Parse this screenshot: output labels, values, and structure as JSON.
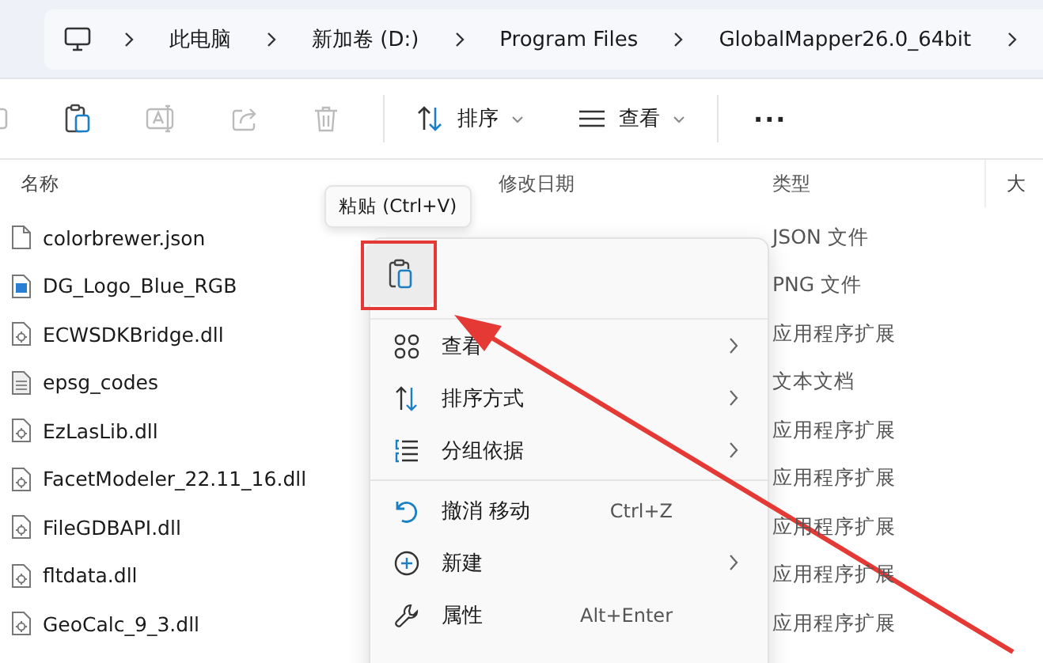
{
  "breadcrumb": [
    "此电脑",
    "新加卷 (D:)",
    "Program Files",
    "GlobalMapper26.0_64bit"
  ],
  "toolbar": {
    "sort": "排序",
    "view": "查看",
    "more": "···"
  },
  "columns": [
    "名称",
    "修改日期",
    "类型",
    "大"
  ],
  "rows": [
    {
      "kind": "json",
      "name": "colorbrewer.json",
      "type": "JSON 文件"
    },
    {
      "kind": "image",
      "name": "DG_Logo_Blue_RGB",
      "type": "PNG 文件"
    },
    {
      "kind": "dll",
      "name": "ECWSDKBridge.dll",
      "type": "应用程序扩展"
    },
    {
      "kind": "text",
      "name": "epsg_codes",
      "type": "文本文档"
    },
    {
      "kind": "dll",
      "name": "EzLasLib.dll",
      "type": "应用程序扩展"
    },
    {
      "kind": "dll",
      "name": "FacetModeler_22.11_16.dll",
      "type": "应用程序扩展"
    },
    {
      "kind": "dll",
      "name": "FileGDBAPI.dll",
      "type": "应用程序扩展"
    },
    {
      "kind": "dll",
      "name": "fltdata.dll",
      "type": "应用程序扩展"
    },
    {
      "kind": "dll",
      "name": "GeoCalc_9_3.dll",
      "type": "应用程序扩展"
    }
  ],
  "tooltip": "粘贴 (Ctrl+V)",
  "menu": [
    {
      "label": "查看",
      "submenu": true
    },
    {
      "label": "排序方式",
      "submenu": true
    },
    {
      "label": "分组依据",
      "submenu": true
    },
    {
      "label": "撤消 移动",
      "shortcut": "Ctrl+Z",
      "submenu": false
    },
    {
      "label": "新建",
      "submenu": true
    },
    {
      "label": "属性",
      "shortcut": "Alt+Enter",
      "submenu": false
    }
  ]
}
